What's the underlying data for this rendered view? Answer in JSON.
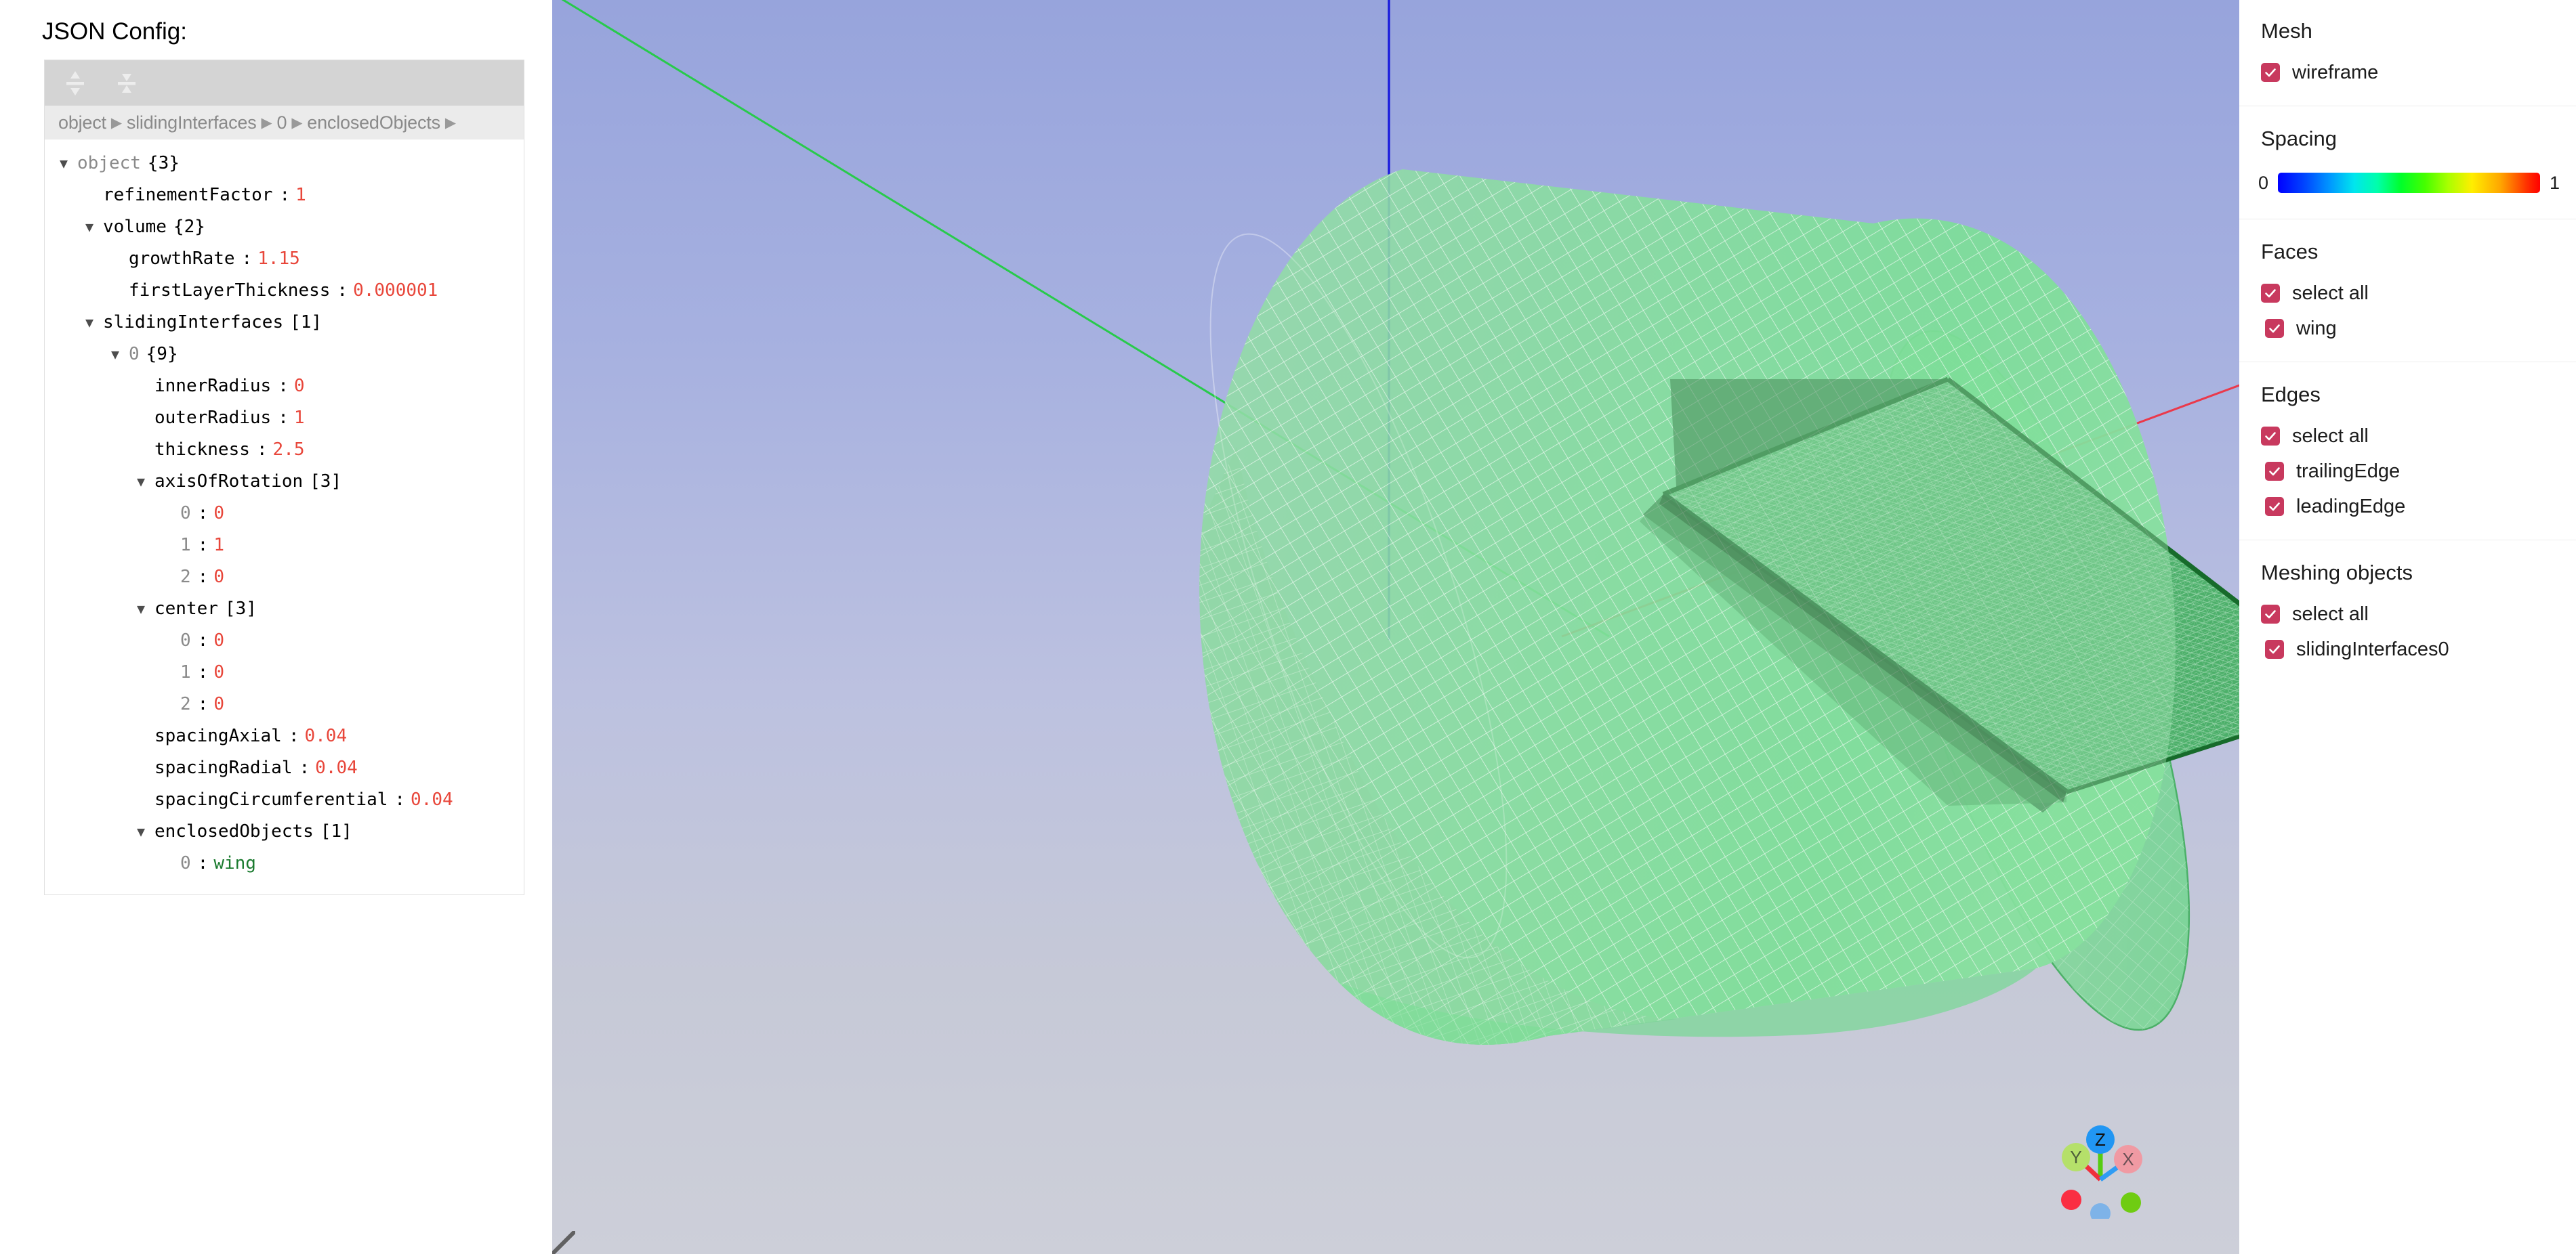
{
  "left_panel": {
    "title": "JSON Config:",
    "toolbar": {
      "expand_all": "expand-all",
      "collapse_all": "collapse-all"
    },
    "breadcrumb": [
      "object",
      "slidingInterfaces",
      "0",
      "enclosedObjects"
    ],
    "breadcrumb_separator": "▶",
    "tree": [
      {
        "indent": 0,
        "caret": "▼",
        "key": "object",
        "dim": true,
        "count": "{3}",
        "value": null,
        "vtype": "none"
      },
      {
        "indent": 1,
        "caret": "",
        "key": "refinementFactor",
        "dim": false,
        "count": "",
        "value": "1",
        "vtype": "num"
      },
      {
        "indent": 1,
        "caret": "▼",
        "key": "volume",
        "dim": false,
        "count": "{2}",
        "value": null,
        "vtype": "none"
      },
      {
        "indent": 2,
        "caret": "",
        "key": "growthRate",
        "dim": false,
        "count": "",
        "value": "1.15",
        "vtype": "num"
      },
      {
        "indent": 2,
        "caret": "",
        "key": "firstLayerThickness",
        "dim": false,
        "count": "",
        "value": "0.000001",
        "vtype": "num"
      },
      {
        "indent": 1,
        "caret": "▼",
        "key": "slidingInterfaces",
        "dim": false,
        "count": "[1]",
        "value": null,
        "vtype": "none"
      },
      {
        "indent": 2,
        "caret": "▼",
        "key": "0",
        "dim": true,
        "count": "{9}",
        "value": null,
        "vtype": "none"
      },
      {
        "indent": 3,
        "caret": "",
        "key": "innerRadius",
        "dim": false,
        "count": "",
        "value": "0",
        "vtype": "num"
      },
      {
        "indent": 3,
        "caret": "",
        "key": "outerRadius",
        "dim": false,
        "count": "",
        "value": "1",
        "vtype": "num"
      },
      {
        "indent": 3,
        "caret": "",
        "key": "thickness",
        "dim": false,
        "count": "",
        "value": "2.5",
        "vtype": "num"
      },
      {
        "indent": 3,
        "caret": "▼",
        "key": "axisOfRotation",
        "dim": false,
        "count": "[3]",
        "value": null,
        "vtype": "none"
      },
      {
        "indent": 4,
        "caret": "",
        "key": "0",
        "dim": true,
        "count": "",
        "value": "0",
        "vtype": "num"
      },
      {
        "indent": 4,
        "caret": "",
        "key": "1",
        "dim": true,
        "count": "",
        "value": "1",
        "vtype": "num"
      },
      {
        "indent": 4,
        "caret": "",
        "key": "2",
        "dim": true,
        "count": "",
        "value": "0",
        "vtype": "num"
      },
      {
        "indent": 3,
        "caret": "▼",
        "key": "center",
        "dim": false,
        "count": "[3]",
        "value": null,
        "vtype": "none"
      },
      {
        "indent": 4,
        "caret": "",
        "key": "0",
        "dim": true,
        "count": "",
        "value": "0",
        "vtype": "num"
      },
      {
        "indent": 4,
        "caret": "",
        "key": "1",
        "dim": true,
        "count": "",
        "value": "0",
        "vtype": "num"
      },
      {
        "indent": 4,
        "caret": "",
        "key": "2",
        "dim": true,
        "count": "",
        "value": "0",
        "vtype": "num"
      },
      {
        "indent": 3,
        "caret": "",
        "key": "spacingAxial",
        "dim": false,
        "count": "",
        "value": "0.04",
        "vtype": "num"
      },
      {
        "indent": 3,
        "caret": "",
        "key": "spacingRadial",
        "dim": false,
        "count": "",
        "value": "0.04",
        "vtype": "num"
      },
      {
        "indent": 3,
        "caret": "",
        "key": "spacingCircumferential",
        "dim": false,
        "count": "",
        "value": "0.04",
        "vtype": "num"
      },
      {
        "indent": 3,
        "caret": "▼",
        "key": "enclosedObjects",
        "dim": false,
        "count": "[1]",
        "value": null,
        "vtype": "none"
      },
      {
        "indent": 4,
        "caret": "",
        "key": "0",
        "dim": true,
        "count": "",
        "value": "wing",
        "vtype": "str"
      }
    ]
  },
  "viewport": {
    "axis_gizmo": {
      "labels": [
        {
          "name": "z",
          "text": "Z",
          "color": "#2196f3"
        },
        {
          "name": "y",
          "text": "Y",
          "color": "#b5e06a"
        },
        {
          "name": "x",
          "text": "X",
          "color": "#f09aa3"
        }
      ],
      "axis_line_colors": {
        "x": "#2f9cf4",
        "y": "#f0303c",
        "z": "#56cc12"
      },
      "dot_colors": {
        "neg_y": "#fa2e42",
        "neg_x": "#6fcc12",
        "neg_z": "#7eb3e8"
      }
    },
    "axis_lines": {
      "x_color": "#ee3344",
      "y_color": "#22cc44",
      "z_color": "#1414dd"
    },
    "mesh_colors": {
      "cylinder_fill": "#6fdd8c",
      "wireframe": "#ffffff",
      "wing_fill": "#4bb867",
      "wing_edge": "#176b2b"
    },
    "background_top": "#97a4dc",
    "background_bottom": "#cdcfd9"
  },
  "right_panel": {
    "sections": [
      {
        "name": "mesh",
        "title": "Mesh",
        "items": [
          {
            "label": "wireframe",
            "checked": true,
            "indent": false
          }
        ]
      },
      {
        "name": "spacing",
        "title": "Spacing",
        "slider": {
          "min": "0",
          "max": "1"
        }
      },
      {
        "name": "faces",
        "title": "Faces",
        "items": [
          {
            "label": "select all",
            "checked": true,
            "indent": false
          },
          {
            "label": "wing",
            "checked": true,
            "indent": true
          }
        ]
      },
      {
        "name": "edges",
        "title": "Edges",
        "items": [
          {
            "label": "select all",
            "checked": true,
            "indent": false
          },
          {
            "label": "trailingEdge",
            "checked": true,
            "indent": true
          },
          {
            "label": "leadingEdge",
            "checked": true,
            "indent": true
          }
        ]
      },
      {
        "name": "meshing-objects",
        "title": "Meshing objects",
        "items": [
          {
            "label": "select all",
            "checked": true,
            "indent": false
          },
          {
            "label": "slidingInterfaces0",
            "checked": true,
            "indent": true
          }
        ]
      }
    ],
    "checkbox_color": "#c8395e"
  }
}
